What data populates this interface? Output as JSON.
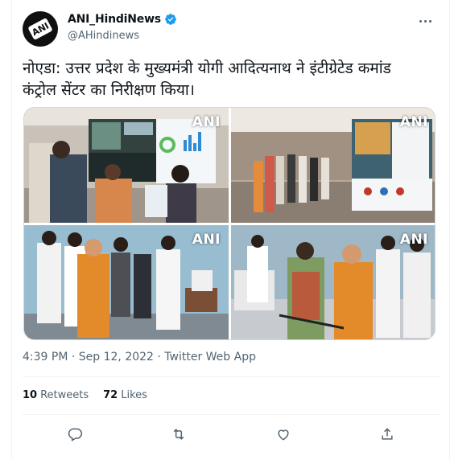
{
  "author": {
    "display_name": "ANI_HindiNews",
    "handle": "@AHindinews",
    "avatar_text": "ANI"
  },
  "tweet": {
    "text": "नोएडा: उत्तर प्रदेश के मुख्यमंत्री योगी आदित्यनाथ ने इंटीग्रेटेड कमांड कंट्रोल सेंटर का निरीक्षण किया।",
    "timestamp": "4:39 PM · Sep 12, 2022 · Twitter Web App"
  },
  "media": {
    "watermark": "ANI",
    "photos": [
      "photo-1",
      "photo-2",
      "photo-3",
      "photo-4"
    ]
  },
  "stats": {
    "retweets_count": "10",
    "retweets_label": "Retweets",
    "likes_count": "72",
    "likes_label": "Likes"
  },
  "icons": {
    "reply": "reply-icon",
    "retweet": "retweet-icon",
    "like": "heart-icon",
    "share": "share-icon",
    "more": "more-icon",
    "verified": "verified-badge-icon"
  },
  "colors": {
    "verified_blue": "#1d9bf0",
    "secondary_text": "#536471",
    "saffron": "#e38a2a"
  }
}
